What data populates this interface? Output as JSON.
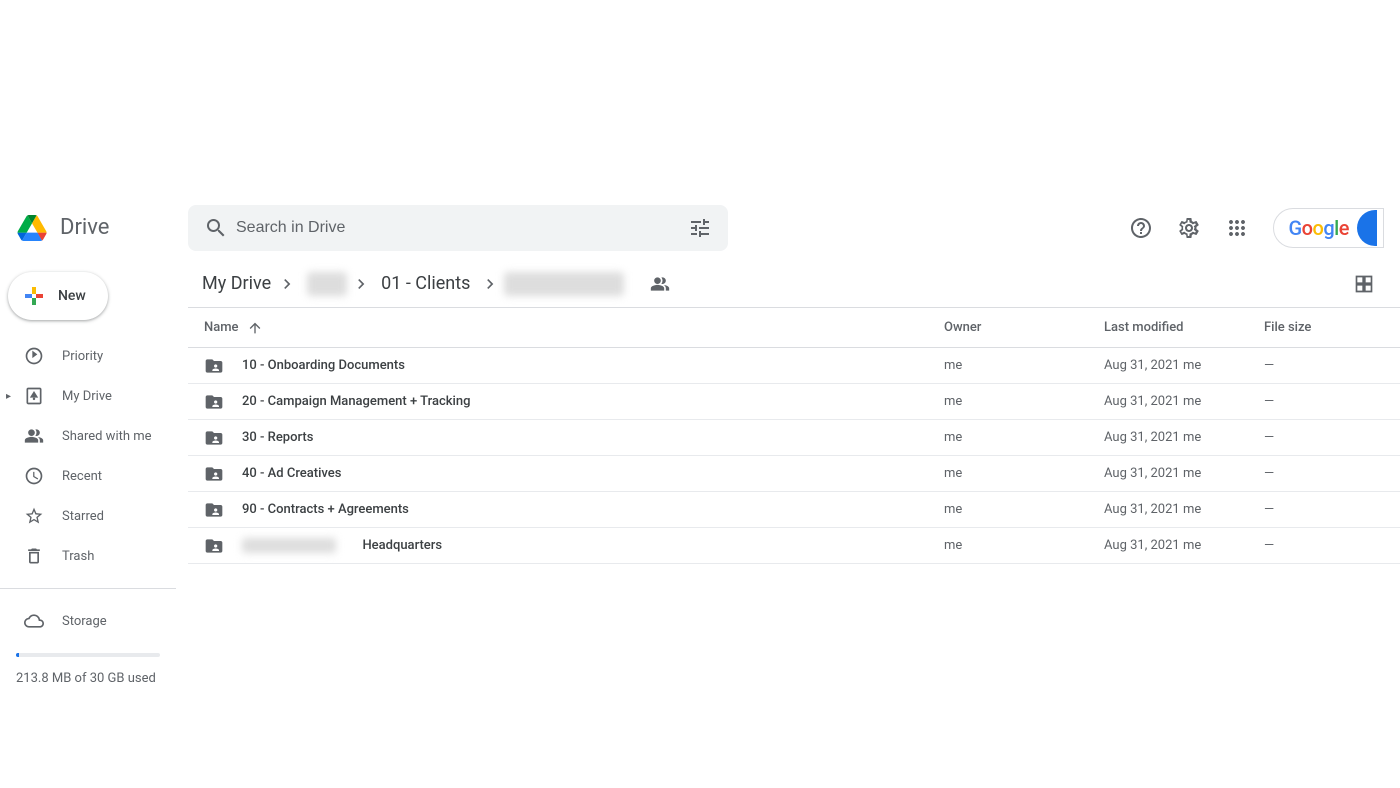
{
  "app_name": "Drive",
  "search": {
    "placeholder": "Search in Drive"
  },
  "new_button": "New",
  "sidebar": {
    "items": [
      {
        "label": "Priority"
      },
      {
        "label": "My Drive"
      },
      {
        "label": "Shared with me"
      },
      {
        "label": "Recent"
      },
      {
        "label": "Starred"
      },
      {
        "label": "Trash"
      },
      {
        "label": "Storage"
      }
    ],
    "storage_text": "213.8 MB of 30 GB used"
  },
  "breadcrumb": {
    "root": "My Drive",
    "clients": "01 - Clients"
  },
  "columns": {
    "name": "Name",
    "owner": "Owner",
    "modified": "Last modified",
    "size": "File size"
  },
  "rows": [
    {
      "name": "10 - Onboarding Documents",
      "owner": "me",
      "modified_date": "Aug 31, 2021",
      "modified_by": "me",
      "size": "—"
    },
    {
      "name": "20 - Campaign Management + Tracking",
      "owner": "me",
      "modified_date": "Aug 31, 2021",
      "modified_by": "me",
      "size": "—"
    },
    {
      "name": "30 - Reports",
      "owner": "me",
      "modified_date": "Aug 31, 2021",
      "modified_by": "me",
      "size": "—"
    },
    {
      "name": "40 - Ad Creatives",
      "owner": "me",
      "modified_date": "Aug 31, 2021",
      "modified_by": "me",
      "size": "—"
    },
    {
      "name": "90 - Contracts + Agreements",
      "owner": "me",
      "modified_date": "Aug 31, 2021",
      "modified_by": "me",
      "size": "—"
    },
    {
      "name": "Headquarters",
      "owner": "me",
      "modified_date": "Aug 31, 2021",
      "modified_by": "me",
      "size": "—",
      "redacted_prefix": true
    }
  ]
}
